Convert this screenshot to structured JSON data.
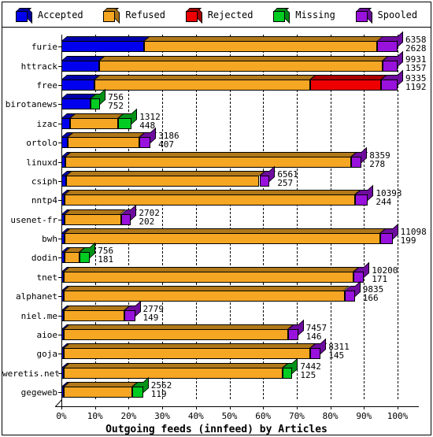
{
  "chart_data": {
    "type": "bar",
    "orientation": "horizontal",
    "stacked": true,
    "title": "Outgoing feeds (innfeed) by Articles",
    "xlabel": "Outgoing feeds (innfeed) by Articles",
    "ylabel": "",
    "xlim": [
      0,
      100
    ],
    "xunit": "%",
    "grid": true,
    "legend_position": "top",
    "xticks": [
      "0%",
      "10%",
      "20%",
      "30%",
      "40%",
      "50%",
      "60%",
      "70%",
      "80%",
      "90%",
      "100%"
    ],
    "xtick_values": [
      0,
      10,
      20,
      30,
      40,
      50,
      60,
      70,
      80,
      90,
      100
    ],
    "legend": [
      {
        "name": "Accepted",
        "color": "#0000ee"
      },
      {
        "name": "Refused",
        "color": "#f5a623"
      },
      {
        "name": "Rejected",
        "color": "#ee0000"
      },
      {
        "name": "Missing",
        "color": "#00cc22"
      },
      {
        "name": "Spooled",
        "color": "#9911dd"
      }
    ],
    "series": [
      {
        "name": "Accepted",
        "color": "#0000ee"
      },
      {
        "name": "Refused",
        "color": "#f5a623"
      },
      {
        "name": "Rejected",
        "color": "#ee0000"
      },
      {
        "name": "Missing",
        "color": "#00cc22"
      },
      {
        "name": "Spooled",
        "color": "#9911dd"
      }
    ],
    "categories": [
      "furie",
      "httrack",
      "free",
      "birotanews",
      "izac",
      "ortolo",
      "linuxd",
      "csiph",
      "nntp4",
      "usenet-fr",
      "bwh",
      "dodin",
      "tnet",
      "alphanet",
      "niel.me",
      "aioe",
      "goja",
      "weretis.net",
      "gegeweb"
    ],
    "rows": [
      {
        "label": "furie",
        "total": 6358,
        "second": 2628,
        "segments": [
          {
            "series": "Accepted",
            "pct": 24.5
          },
          {
            "series": "Refused",
            "pct": 69.5
          },
          {
            "series": "Spooled",
            "pct": 6.0
          }
        ]
      },
      {
        "label": "httrack",
        "total": 9931,
        "second": 1357,
        "segments": [
          {
            "series": "Accepted",
            "pct": 11.2
          },
          {
            "series": "Refused",
            "pct": 84.3
          },
          {
            "series": "Spooled",
            "pct": 4.5
          }
        ]
      },
      {
        "label": "free",
        "total": 9335,
        "second": 1192,
        "segments": [
          {
            "series": "Accepted",
            "pct": 9.9
          },
          {
            "series": "Refused",
            "pct": 64.1
          },
          {
            "series": "Rejected",
            "pct": 21.0
          },
          {
            "series": "Spooled",
            "pct": 5.0
          }
        ]
      },
      {
        "label": "birotanews",
        "total": 756,
        "second": 752,
        "segments": [
          {
            "series": "Accepted",
            "pct": 8.7
          },
          {
            "series": "Missing",
            "pct": 2.8
          }
        ]
      },
      {
        "label": "izac",
        "total": 1312,
        "second": 448,
        "segments": [
          {
            "series": "Accepted",
            "pct": 2.6
          },
          {
            "series": "Refused",
            "pct": 14.3
          },
          {
            "series": "Missing",
            "pct": 4.0
          }
        ]
      },
      {
        "label": "ortolo",
        "total": 3186,
        "second": 407,
        "segments": [
          {
            "series": "Accepted",
            "pct": 1.8
          },
          {
            "series": "Refused",
            "pct": 21.3
          },
          {
            "series": "Spooled",
            "pct": 3.4
          }
        ]
      },
      {
        "label": "linuxd",
        "total": 8359,
        "second": 278,
        "segments": [
          {
            "series": "Accepted",
            "pct": 1.1
          },
          {
            "series": "Refused",
            "pct": 85.0
          },
          {
            "series": "Spooled",
            "pct": 3.2
          }
        ]
      },
      {
        "label": "csiph",
        "total": 6561,
        "second": 257,
        "segments": [
          {
            "series": "Accepted",
            "pct": 1.4
          },
          {
            "series": "Refused",
            "pct": 57.5
          },
          {
            "series": "Spooled",
            "pct": 3.0
          }
        ]
      },
      {
        "label": "nntp4",
        "total": 10393,
        "second": 244,
        "segments": [
          {
            "series": "Accepted",
            "pct": 1.0
          },
          {
            "series": "Refused",
            "pct": 86.4
          },
          {
            "series": "Spooled",
            "pct": 3.8
          }
        ]
      },
      {
        "label": "usenet-fr",
        "total": 2702,
        "second": 202,
        "segments": [
          {
            "series": "Accepted",
            "pct": 1.0
          },
          {
            "series": "Refused",
            "pct": 16.7
          },
          {
            "series": "Spooled",
            "pct": 3.0
          }
        ]
      },
      {
        "label": "bwh",
        "total": 11098,
        "second": 199,
        "segments": [
          {
            "series": "Accepted",
            "pct": 0.9
          },
          {
            "series": "Refused",
            "pct": 93.9
          },
          {
            "series": "Spooled",
            "pct": 3.7
          }
        ]
      },
      {
        "label": "dodin",
        "total": 756,
        "second": 181,
        "segments": [
          {
            "series": "Accepted",
            "pct": 0.9
          },
          {
            "series": "Refused",
            "pct": 4.4
          },
          {
            "series": "Missing",
            "pct": 3.2
          }
        ]
      },
      {
        "label": "tnet",
        "total": 10200,
        "second": 171,
        "segments": [
          {
            "series": "Accepted",
            "pct": 0.8
          },
          {
            "series": "Refused",
            "pct": 86.2
          },
          {
            "series": "Spooled",
            "pct": 3.0
          }
        ]
      },
      {
        "label": "alphanet",
        "total": 9835,
        "second": 166,
        "segments": [
          {
            "series": "Accepted",
            "pct": 0.8
          },
          {
            "series": "Refused",
            "pct": 83.4
          },
          {
            "series": "Spooled",
            "pct": 3.1
          }
        ]
      },
      {
        "label": "niel.me",
        "total": 2779,
        "second": 149,
        "segments": [
          {
            "series": "Accepted",
            "pct": 0.7
          },
          {
            "series": "Refused",
            "pct": 18.0
          },
          {
            "series": "Spooled",
            "pct": 3.2
          }
        ]
      },
      {
        "label": "aioe",
        "total": 7457,
        "second": 146,
        "segments": [
          {
            "series": "Accepted",
            "pct": 0.7
          },
          {
            "series": "Refused",
            "pct": 66.7
          },
          {
            "series": "Spooled",
            "pct": 3.0
          }
        ]
      },
      {
        "label": "goja",
        "total": 8311,
        "second": 145,
        "segments": [
          {
            "series": "Accepted",
            "pct": 0.7
          },
          {
            "series": "Refused",
            "pct": 73.2
          },
          {
            "series": "Spooled",
            "pct": 3.2
          }
        ]
      },
      {
        "label": "weretis.net",
        "total": 7442,
        "second": 125,
        "segments": [
          {
            "series": "Accepted",
            "pct": 0.6
          },
          {
            "series": "Refused",
            "pct": 65.2
          },
          {
            "series": "Missing",
            "pct": 2.9
          }
        ]
      },
      {
        "label": "gegeweb",
        "total": 2562,
        "second": 119,
        "segments": [
          {
            "series": "Accepted",
            "pct": 0.6
          },
          {
            "series": "Refused",
            "pct": 20.4
          },
          {
            "series": "Missing",
            "pct": 3.3
          }
        ]
      }
    ]
  }
}
